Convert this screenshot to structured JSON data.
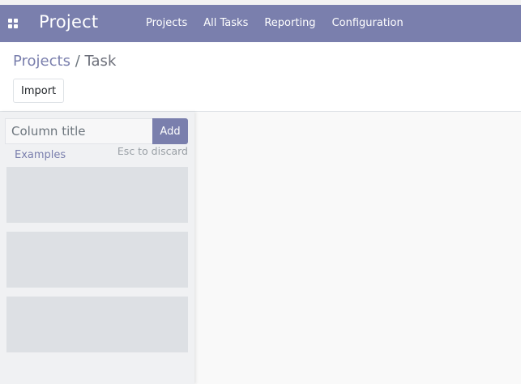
{
  "navbar": {
    "brand": "Project",
    "menu": [
      "Projects",
      "All Tasks",
      "Reporting",
      "Configuration"
    ]
  },
  "control_panel": {
    "breadcrumb_parent": "Projects",
    "breadcrumb_separator": "/",
    "breadcrumb_current": "Task",
    "import_label": "Import"
  },
  "quick_create": {
    "column_placeholder": "Column title",
    "column_value": "",
    "add_label": "Add",
    "examples_label": "Examples",
    "discard_hint": "Esc to discard",
    "ghost_card_count": 3
  },
  "colors": {
    "navbar": "#7a7fad",
    "accent": "#7a7fad",
    "ghost_card": "#dde0e4",
    "kanban_background": "#f9f9f9"
  },
  "icons": {
    "apps_menu": "apps-grid-icon"
  }
}
